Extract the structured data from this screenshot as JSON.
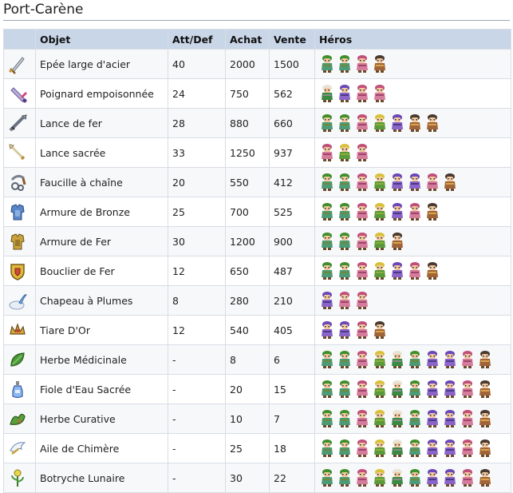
{
  "page": {
    "title": "Port-Carène"
  },
  "table": {
    "headers": {
      "icon": "",
      "name": "Objet",
      "stat": "Att/Def",
      "buy": "Achat",
      "sell": "Vente",
      "heroes": "Héros"
    },
    "rows": [
      {
        "icon": "broadsword-icon",
        "name": "Epée large d'acier",
        "stat": "40",
        "buy": "2000",
        "sell": "1500",
        "heroes": [
          "green-hero",
          "green-hero",
          "pink-hero",
          "dark-hero"
        ]
      },
      {
        "icon": "poison-dagger-icon",
        "name": "Poignard empoisonnée",
        "stat": "24",
        "buy": "750",
        "sell": "562",
        "heroes": [
          "white-hero",
          "purple-hero",
          "pink-hero",
          "pink-hero"
        ]
      },
      {
        "icon": "iron-lance-icon",
        "name": "Lance de fer",
        "stat": "28",
        "buy": "880",
        "sell": "660",
        "heroes": [
          "green-hero",
          "green-hero",
          "pink-hero",
          "yellow-hero",
          "purple-hero",
          "dark-hero",
          "dark-hero"
        ]
      },
      {
        "icon": "holy-lance-icon",
        "name": "Lance sacrée",
        "stat": "33",
        "buy": "1250",
        "sell": "937",
        "heroes": [
          "pink-hero",
          "yellow-hero",
          "pink-hero"
        ]
      },
      {
        "icon": "chain-sickle-icon",
        "name": "Faucille à chaîne",
        "stat": "20",
        "buy": "550",
        "sell": "412",
        "heroes": [
          "green-hero",
          "green-hero",
          "pink-hero",
          "yellow-hero",
          "purple-hero",
          "purple-hero",
          "pink-hero",
          "dark-hero"
        ]
      },
      {
        "icon": "bronze-armour-icon",
        "name": "Armure de Bronze",
        "stat": "25",
        "buy": "700",
        "sell": "525",
        "heroes": [
          "green-hero",
          "green-hero",
          "pink-hero",
          "yellow-hero",
          "purple-hero",
          "pink-hero",
          "dark-hero"
        ]
      },
      {
        "icon": "iron-armour-icon",
        "name": "Armure de Fer",
        "stat": "30",
        "buy": "1200",
        "sell": "900",
        "heroes": [
          "green-hero",
          "green-hero",
          "pink-hero",
          "yellow-hero",
          "dark-hero"
        ]
      },
      {
        "icon": "iron-shield-icon",
        "name": "Bouclier de Fer",
        "stat": "12",
        "buy": "650",
        "sell": "487",
        "heroes": [
          "green-hero",
          "green-hero",
          "pink-hero",
          "yellow-hero",
          "purple-hero",
          "pink-hero",
          "dark-hero"
        ]
      },
      {
        "icon": "feather-hat-icon",
        "name": "Chapeau à Plumes",
        "stat": "8",
        "buy": "280",
        "sell": "210",
        "heroes": [
          "purple-hero",
          "pink-hero",
          "pink-hero"
        ]
      },
      {
        "icon": "gold-tiara-icon",
        "name": "Tiare D'Or",
        "stat": "12",
        "buy": "540",
        "sell": "405",
        "heroes": [
          "purple-hero",
          "purple-hero",
          "pink-hero",
          "dark-hero"
        ]
      },
      {
        "icon": "medicinal-herb-icon",
        "name": "Herbe Médicinale",
        "stat": "-",
        "buy": "8",
        "sell": "6",
        "heroes": [
          "green-hero",
          "green-hero",
          "pink-hero",
          "yellow-hero",
          "white-hero",
          "green-hero",
          "purple-hero",
          "purple-hero",
          "pink-hero",
          "dark-hero"
        ]
      },
      {
        "icon": "holy-water-icon",
        "name": "Fiole d'Eau Sacrée",
        "stat": "-",
        "buy": "20",
        "sell": "15",
        "heroes": [
          "green-hero",
          "green-hero",
          "pink-hero",
          "yellow-hero",
          "white-hero",
          "green-hero",
          "purple-hero",
          "purple-hero",
          "pink-hero",
          "dark-hero"
        ]
      },
      {
        "icon": "curative-herb-icon",
        "name": "Herbe Curative",
        "stat": "-",
        "buy": "10",
        "sell": "7",
        "heroes": [
          "green-hero",
          "green-hero",
          "pink-hero",
          "yellow-hero",
          "white-hero",
          "green-hero",
          "purple-hero",
          "purple-hero",
          "pink-hero",
          "dark-hero"
        ]
      },
      {
        "icon": "chimaera-wing-icon",
        "name": "Aile de Chimère",
        "stat": "-",
        "buy": "25",
        "sell": "18",
        "heroes": [
          "green-hero",
          "green-hero",
          "pink-hero",
          "yellow-hero",
          "white-hero",
          "green-hero",
          "purple-hero",
          "purple-hero",
          "pink-hero",
          "dark-hero"
        ]
      },
      {
        "icon": "moonwort-icon",
        "name": "Botryche Lunaire",
        "stat": "-",
        "buy": "30",
        "sell": "22",
        "heroes": [
          "green-hero",
          "green-hero",
          "pink-hero",
          "yellow-hero",
          "white-hero",
          "green-hero",
          "purple-hero",
          "purple-hero",
          "pink-hero",
          "dark-hero"
        ]
      }
    ]
  },
  "colors": {
    "header_bg": "#c9d6e8",
    "border": "#d8dde4",
    "row_alt": "#f7f8fa",
    "heroes": {
      "green-hero": {
        "hair": "#3f8f2e",
        "body": "#4d9a77",
        "accent": "#6c8a3a"
      },
      "pink-hero": {
        "hair": "#c0507a",
        "body": "#d57b9c",
        "accent": "#a04569"
      },
      "dark-hero": {
        "hair": "#4a3a30",
        "body": "#a06438",
        "accent": "#d9a54a"
      },
      "white-hero": {
        "hair": "#e8e4d6",
        "body": "#3a8a43",
        "accent": "#8a8a8a"
      },
      "purple-hero": {
        "hair": "#6a48b8",
        "body": "#8a64c8",
        "accent": "#4a3a8a"
      },
      "yellow-hero": {
        "hair": "#d8c23a",
        "body": "#5a9a3a",
        "accent": "#8ab03a"
      }
    }
  }
}
